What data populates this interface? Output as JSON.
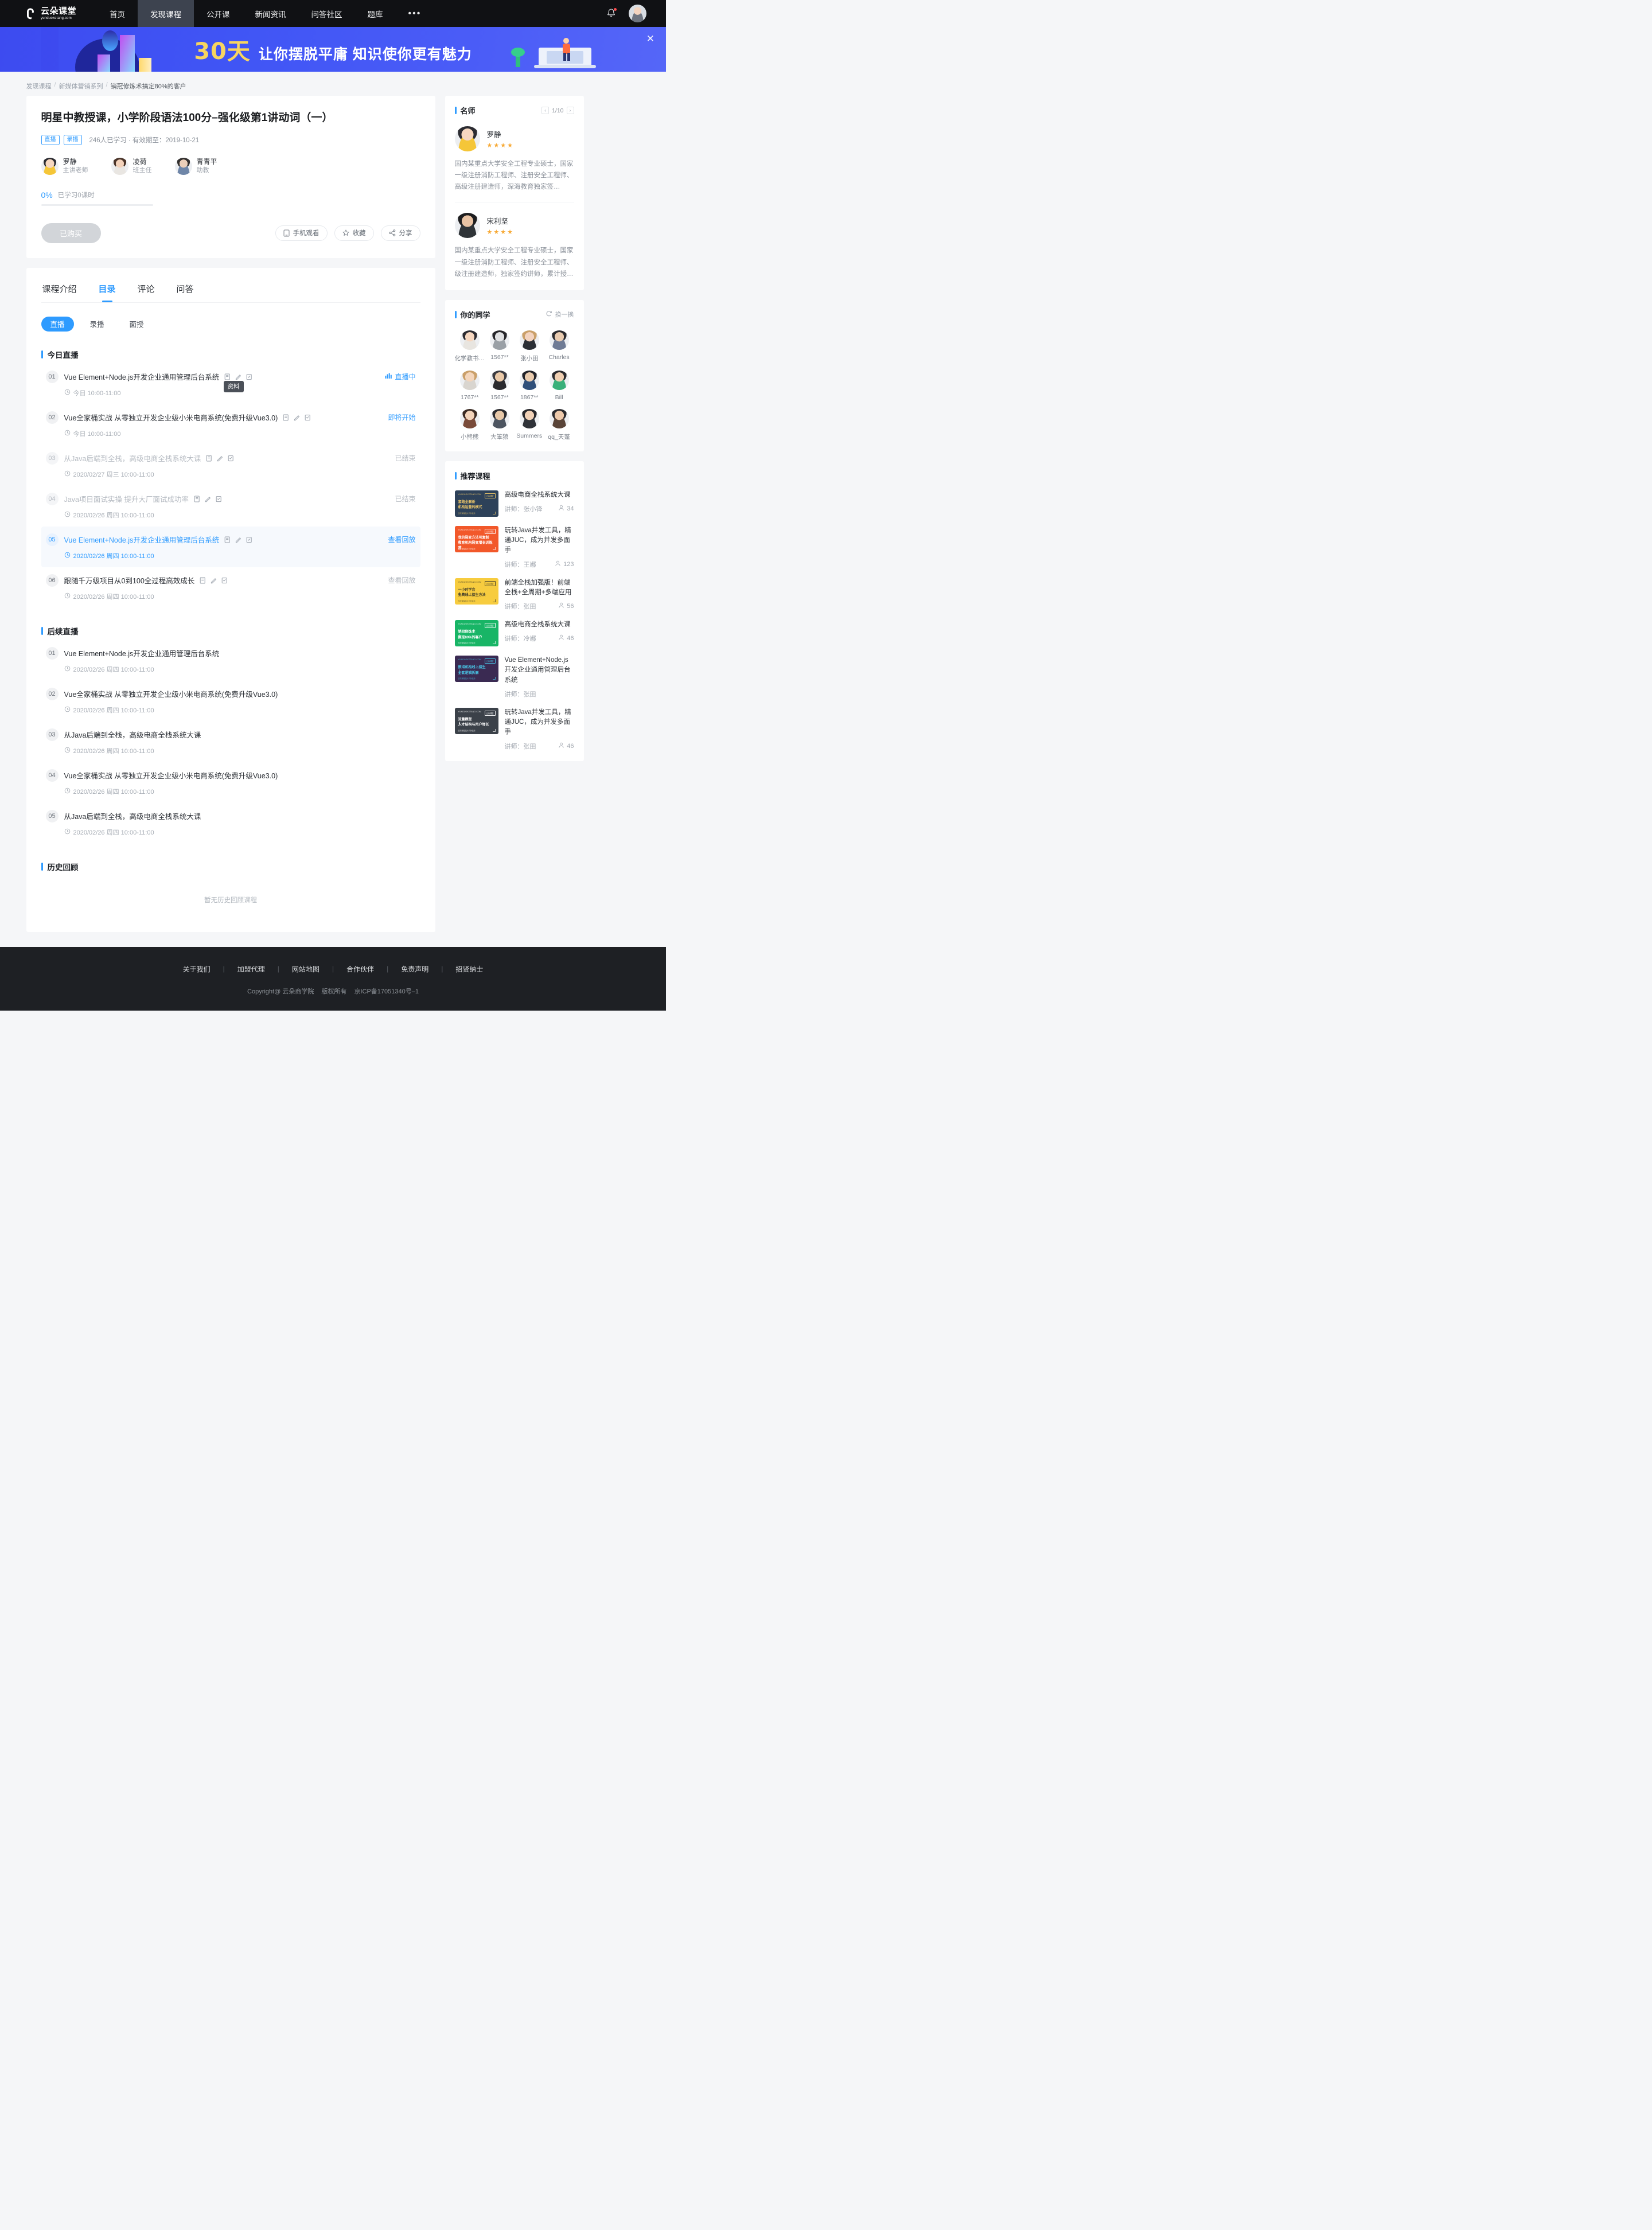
{
  "nav": {
    "brand_cn": "云朵课堂",
    "brand_en": "yunduoketang.com",
    "items": [
      {
        "label": "首页",
        "active": false
      },
      {
        "label": "发现课程",
        "active": true
      },
      {
        "label": "公开课",
        "active": false
      },
      {
        "label": "新闻资讯",
        "active": false
      },
      {
        "label": "问答社区",
        "active": false
      },
      {
        "label": "题库",
        "active": false
      },
      {
        "label": "•••",
        "active": false
      }
    ]
  },
  "banner": {
    "days": "30天",
    "headline": "让你摆脱平庸  知识使你更有魅力",
    "close": "✕"
  },
  "breadcrumb": {
    "items": [
      "发现课程",
      "新媒体营销系列",
      "销冠修炼术搞定80%的客户"
    ],
    "sep": "/"
  },
  "course": {
    "title": "明星中教授课，小学阶段语法100分–强化级第1讲动词（一）",
    "tags": [
      "直播",
      "录播"
    ],
    "meta": "246人已学习 · 有效期至：2019-10-21",
    "teachers": [
      {
        "name": "罗静",
        "role": "主讲老师"
      },
      {
        "name": "凌荷",
        "role": "班主任"
      },
      {
        "name": "青青平",
        "role": "助教"
      }
    ],
    "progress_pct": "0%",
    "progress_label": "已学习0课时",
    "progress_value": 0,
    "buy_button": "已购买",
    "actions": [
      {
        "label": "手机观看",
        "icon": "phone-icon"
      },
      {
        "label": "收藏",
        "icon": "star-icon"
      },
      {
        "label": "分享",
        "icon": "share-icon"
      }
    ]
  },
  "tabs": [
    {
      "label": "课程介绍",
      "active": false
    },
    {
      "label": "目录",
      "active": true
    },
    {
      "label": "评论",
      "active": false
    },
    {
      "label": "问答",
      "active": false
    }
  ],
  "subtabs": [
    {
      "label": "直播",
      "active": true
    },
    {
      "label": "录播",
      "active": false
    },
    {
      "label": "面授",
      "active": false
    }
  ],
  "tooltip": "资料",
  "sections": [
    {
      "title": "今日直播",
      "lessons": [
        {
          "num": "01",
          "title": "Vue Element+Node.js开发企业通用管理后台系统",
          "time": "今日 10:00-11:00",
          "status": "直播中",
          "status_type": "live",
          "has_icons": true,
          "state": "normal"
        },
        {
          "num": "02",
          "title": "Vue全家桶实战 从零独立开发企业级小米电商系统(免费升级Vue3.0)",
          "time": "今日 10:00-11:00",
          "status": "即将开始",
          "status_type": "soon",
          "has_icons": true,
          "state": "normal"
        },
        {
          "num": "03",
          "title": "从Java后端到全栈，高级电商全栈系统大课",
          "time": "2020/02/27 周三 10:00-11:00",
          "status": "已结束",
          "status_type": "done",
          "has_icons": true,
          "state": "ended"
        },
        {
          "num": "04",
          "title": "Java项目面试实操 提升大厂面试成功率",
          "time": "2020/02/26 周四 10:00-11:00",
          "status": "已结束",
          "status_type": "done",
          "has_icons": true,
          "state": "ended"
        },
        {
          "num": "05",
          "title": "Vue Element+Node.js开发企业通用管理后台系统",
          "time": "2020/02/26 周四 10:00-11:00",
          "status": "查看回放",
          "status_type": "replay",
          "has_icons": true,
          "state": "highlight"
        },
        {
          "num": "06",
          "title": "跟随千万级项目从0到100全过程高效成长",
          "time": "2020/02/26 周四 10:00-11:00",
          "status": "查看回放",
          "status_type": "replay-grey",
          "has_icons": true,
          "state": "normal"
        }
      ]
    },
    {
      "title": "后续直播",
      "lessons": [
        {
          "num": "01",
          "title": "Vue Element+Node.js开发企业通用管理后台系统",
          "time": "2020/02/26 周四 10:00-11:00",
          "status": "",
          "status_type": "",
          "has_icons": false,
          "state": "normal"
        },
        {
          "num": "02",
          "title": "Vue全家桶实战 从零独立开发企业级小米电商系统(免费升级Vue3.0)",
          "time": "2020/02/26 周四 10:00-11:00",
          "status": "",
          "status_type": "",
          "has_icons": false,
          "state": "normal"
        },
        {
          "num": "03",
          "title": "从Java后端到全栈，高级电商全栈系统大课",
          "time": "2020/02/26 周四 10:00-11:00",
          "status": "",
          "status_type": "",
          "has_icons": false,
          "state": "normal"
        },
        {
          "num": "04",
          "title": "Vue全家桶实战 从零独立开发企业级小米电商系统(免费升级Vue3.0)",
          "time": "2020/02/26 周四 10:00-11:00",
          "status": "",
          "status_type": "",
          "has_icons": false,
          "state": "normal"
        },
        {
          "num": "05",
          "title": "从Java后端到全栈，高级电商全栈系统大课",
          "time": "2020/02/26 周四 10:00-11:00",
          "status": "",
          "status_type": "",
          "has_icons": false,
          "state": "normal"
        }
      ]
    },
    {
      "title": "历史回顾",
      "lessons": [],
      "empty_text": "暂无历史回顾课程"
    }
  ],
  "sidebar": {
    "famous": {
      "title": "名师",
      "page": "1/10",
      "prev": "‹",
      "next": "›",
      "teachers": [
        {
          "name": "罗静",
          "stars": "★★★★",
          "desc": "国内某重点大学安全工程专业硕士，国家一级注册消防工程师、注册安全工程师、高级注册建造师，深海教育独家签…"
        },
        {
          "name": "宋利坚",
          "stars": "★★★★",
          "desc": "国内某重点大学安全工程专业硕士，国家一级注册消防工程师、注册安全工程师、级注册建造师，独家签约讲师，累计授…"
        }
      ]
    },
    "classmates": {
      "title": "你的同学",
      "swap_label": "换一换",
      "people": [
        {
          "name": "化学教书…"
        },
        {
          "name": "1567**"
        },
        {
          "name": "张小田"
        },
        {
          "name": "Charles"
        },
        {
          "name": "1767**"
        },
        {
          "name": "1567**"
        },
        {
          "name": "1867**"
        },
        {
          "name": "Bill"
        },
        {
          "name": "小熊熊"
        },
        {
          "name": "大笨狼"
        },
        {
          "name": "Summers"
        },
        {
          "name": "qq_天蓬"
        }
      ]
    },
    "recommended": {
      "title": "推荐课程",
      "courses": [
        {
          "title": "高级电商全栈系统大课",
          "teacher": "讲师：张小锋",
          "count": "34",
          "thumb_color": "#2d4159",
          "thumb_l1": "套路全解析",
          "thumb_l2": "机构运营的模式",
          "thumb_accent": "#f0c96a"
        },
        {
          "title": "玩转Java并发工具，精通JUC，成为并发多面手",
          "teacher": "讲师：王娜",
          "count": "123",
          "thumb_color": "#f2582a",
          "thumb_l1": "我的裂变方法可复制",
          "thumb_l2": "教育机构裂变增长训练营",
          "thumb_accent": "#ffffff"
        },
        {
          "title": "前端全栈加强版！前端全栈+全周期+多端应用",
          "teacher": "讲师：张田",
          "count": "56",
          "thumb_color": "#f7cc3f",
          "thumb_l1": "一小时学会",
          "thumb_l2": "免费线上招生方法",
          "thumb_accent": "#3d3a2a"
        },
        {
          "title": "高级电商全栈系统大课",
          "teacher": "讲师：冷娜",
          "count": "46",
          "thumb_color": "#18b566",
          "thumb_l1": "销冠修炼术",
          "thumb_l2": "搞定80%的客户",
          "thumb_accent": "#ffffff"
        },
        {
          "title": "Vue Element+Node.js开发企业通用管理后台系统",
          "teacher": "讲师：张田",
          "count": "",
          "thumb_color": "#3a2a52",
          "thumb_l1": "教培机构线上招生",
          "thumb_l2": "全套逻辑拆解",
          "thumb_accent": "#49c7e8"
        },
        {
          "title": "玩转Java并发工具，精通JUC，成为并发多面手",
          "teacher": "讲师：张田",
          "count": "46",
          "thumb_color": "#3b4149",
          "thumb_l1": "流量模型",
          "thumb_l2": "人才结构与用户增长",
          "thumb_accent": "#ffffff"
        }
      ]
    }
  },
  "footer": {
    "links": [
      "关于我们",
      "加盟代理",
      "网站地图",
      "合作伙伴",
      "免责声明",
      "招贤纳士"
    ],
    "sep": "|",
    "copyright": "Copyright@ 云朵商学院",
    "rights": "版权所有",
    "icp": "京ICP备17051340号–1"
  }
}
